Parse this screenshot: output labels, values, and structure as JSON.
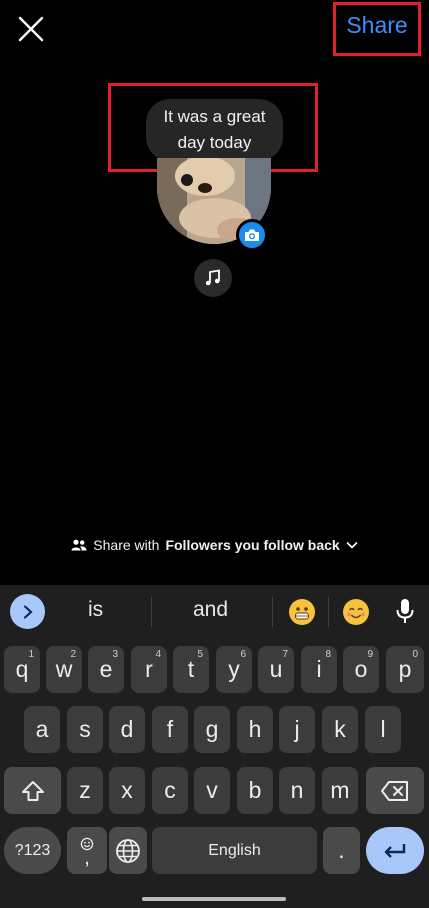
{
  "header": {
    "share_label": "Share"
  },
  "note": {
    "text": "It was a great day today"
  },
  "audience": {
    "prefix": "Share with",
    "group": "Followers you follow back"
  },
  "keyboard": {
    "suggestions": [
      "is",
      "and"
    ],
    "row1": [
      {
        "key": "q",
        "hint": "1"
      },
      {
        "key": "w",
        "hint": "2"
      },
      {
        "key": "e",
        "hint": "3"
      },
      {
        "key": "r",
        "hint": "4"
      },
      {
        "key": "t",
        "hint": "5"
      },
      {
        "key": "y",
        "hint": "6"
      },
      {
        "key": "u",
        "hint": "7"
      },
      {
        "key": "i",
        "hint": "8"
      },
      {
        "key": "o",
        "hint": "9"
      },
      {
        "key": "p",
        "hint": "0"
      }
    ],
    "row2": [
      "a",
      "s",
      "d",
      "f",
      "g",
      "h",
      "j",
      "k",
      "l"
    ],
    "row3": [
      "z",
      "x",
      "c",
      "v",
      "b",
      "n",
      "m"
    ],
    "symbols_label": "?123",
    "comma_label": ",",
    "space_label": "English",
    "period_label": "."
  },
  "colors": {
    "accent": "#3d8fff",
    "highlight": "#e0212b",
    "keyboard_bg": "#1f1f1f",
    "key_bg": "#3c3c3c",
    "enter_bg": "#a8c7fa"
  }
}
